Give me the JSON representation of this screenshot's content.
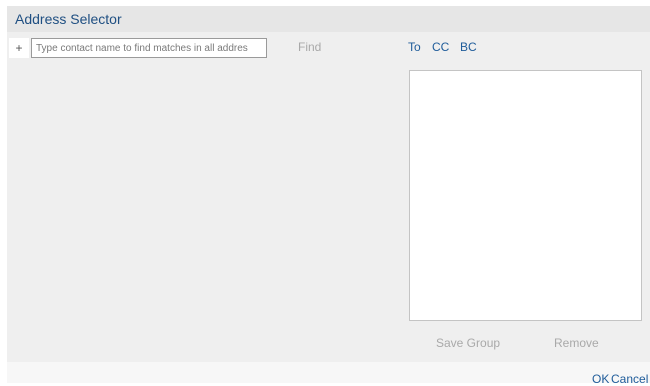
{
  "dialog": {
    "title": "Address Selector"
  },
  "search": {
    "add_label": "+",
    "placeholder": "Type contact name to find matches in all addres",
    "value": "",
    "find_label": "Find"
  },
  "recipient_tabs": [
    {
      "label": "To"
    },
    {
      "label": "CC"
    },
    {
      "label": "BC"
    }
  ],
  "recipients": [],
  "actions": {
    "save_group_label": "Save Group",
    "remove_label": "Remove"
  },
  "footer": {
    "ok_label": "OK",
    "cancel_label": "Cancel"
  },
  "colors": {
    "accent": "#1f5c9a",
    "disabled_text": "#a9a9a9",
    "panel_background": "#efefef"
  }
}
